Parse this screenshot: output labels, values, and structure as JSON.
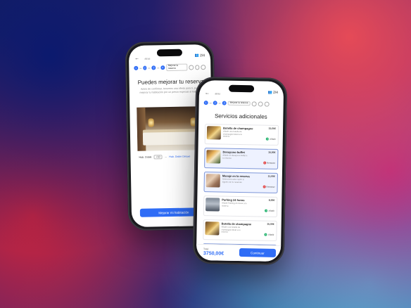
{
  "back_screen": {
    "top_label": "atras",
    "guests": "2/4",
    "steps": [
      "1",
      "2",
      "3",
      "4"
    ],
    "current_step_label": "Mejorar la reserva",
    "title": "Puedes mejorar tu reserva",
    "description": "Antes de confirmar, tenemos una oferta para ti, puedes mejorar tu habitación por un precio especial al habitación",
    "from_room": "Hab. Doble",
    "price_chip": "+50",
    "to_room": "Hab. Doble Deluxe",
    "cta": "Mejorar mi habitación"
  },
  "front_screen": {
    "top_label": "atras",
    "guests": "2/4",
    "steps": [
      "1",
      "2",
      "3"
    ],
    "current_step_label": "Mejorar la reserva",
    "title": "Servicios adicionales",
    "items": [
      {
        "name": "Botella de champagne",
        "desc": "Añade una botella de champagne Moët a tu reserva",
        "price": "15,00€",
        "action": "Añadir",
        "state": "add",
        "thumb": "champagne"
      },
      {
        "name": "Desayuno buffet",
        "desc": "Añade un desayuno buffet a tu reserva",
        "price": "15,00€",
        "action": "Remover",
        "state": "remove",
        "thumb": "breakfast"
      },
      {
        "name": "Masaje en la reserva",
        "desc": "Selecciona este cupón si sigues con tu reservas",
        "price": "11,00€",
        "action": "Remover",
        "state": "remove",
        "thumb": "massage"
      },
      {
        "name": "Parking 24 horas",
        "desc": "Añade Parking 24 horas a tu reserva",
        "price": "8,00€",
        "action": "Añadir",
        "state": "add",
        "thumb": "parking"
      },
      {
        "name": "Botella de champagne",
        "desc": "Añade una botella de champagne Moët a tu reserva",
        "price": "15,00€",
        "action": "Añadir",
        "state": "add",
        "thumb": "champagne"
      },
      {
        "name": "Desayuno buffet",
        "desc": "Añade un desayuno buffet a tu reserva",
        "price": "15,00€",
        "action": "Remover",
        "state": "remove",
        "thumb": "breakfast"
      }
    ],
    "total_label": "Total",
    "total_value": "3750,00€",
    "cta": "Continuar"
  }
}
